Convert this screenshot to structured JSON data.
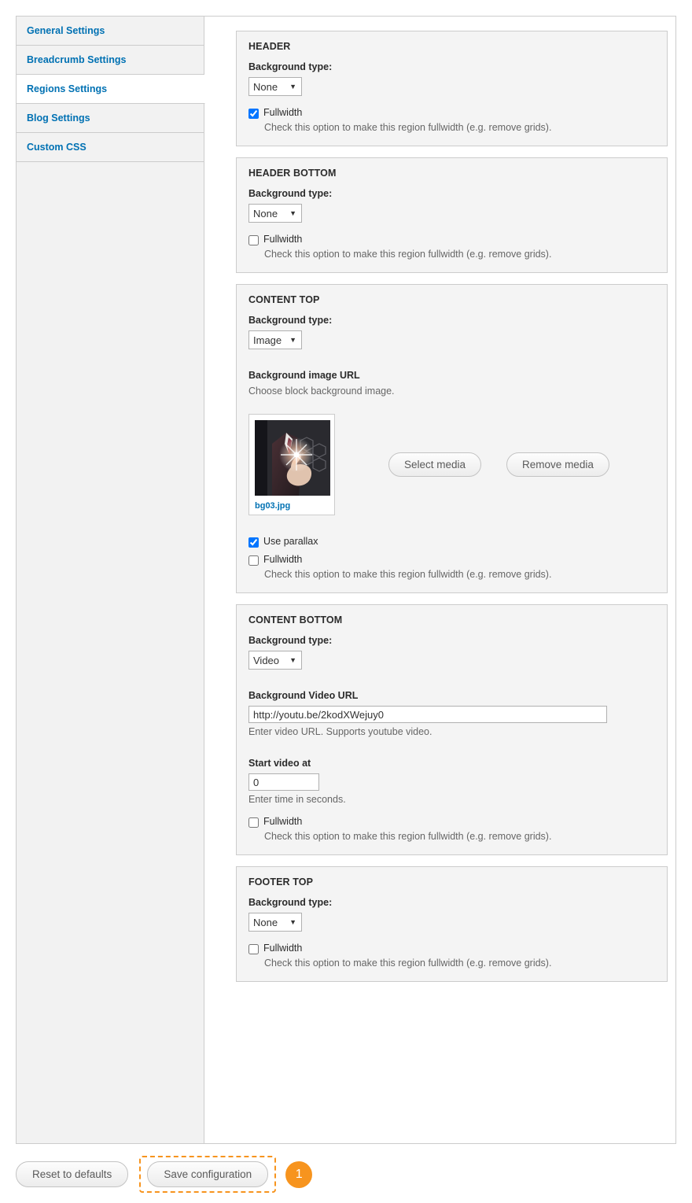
{
  "sidebar": {
    "items": [
      {
        "label": "General Settings",
        "selected": false
      },
      {
        "label": "Breadcrumb Settings",
        "selected": false
      },
      {
        "label": "Regions Settings",
        "selected": true
      },
      {
        "label": "Blog Settings",
        "selected": false
      },
      {
        "label": "Custom CSS",
        "selected": false
      }
    ]
  },
  "common": {
    "background_type_label": "Background type:",
    "fullwidth_label": "Fullwidth",
    "fullwidth_description": "Check this option to make this region fullwidth (e.g. remove grids).",
    "caret_icon": "chevron-down-icon"
  },
  "sections": [
    {
      "legend": "HEADER",
      "background_type_value": "None",
      "fullwidth_checked": true
    },
    {
      "legend": "HEADER BOTTOM",
      "background_type_value": "None",
      "fullwidth_checked": false
    },
    {
      "legend": "CONTENT TOP",
      "background_type_value": "Image",
      "image_url_label": "Background image URL",
      "image_url_description": "Choose block background image.",
      "thumbnail_filename": "bg03.jpg",
      "select_media_label": "Select media",
      "remove_media_label": "Remove media",
      "use_parallax_label": "Use parallax",
      "use_parallax_checked": true,
      "fullwidth_checked": false
    },
    {
      "legend": "CONTENT BOTTOM",
      "background_type_value": "Video",
      "video_url_label": "Background Video URL",
      "video_url_value": "http://youtu.be/2kodXWejuy0",
      "video_url_description": "Enter video URL. Supports youtube video.",
      "start_video_label": "Start video at",
      "start_video_value": "0",
      "start_video_description": "Enter time in seconds.",
      "fullwidth_checked": false
    },
    {
      "legend": "FOOTER TOP",
      "background_type_value": "None",
      "fullwidth_checked": false
    }
  ],
  "actions": {
    "reset_label": "Reset to defaults",
    "save_label": "Save configuration",
    "step_badge": "1",
    "highlight_color": "#f7941e",
    "link_color": "#0071b3"
  }
}
